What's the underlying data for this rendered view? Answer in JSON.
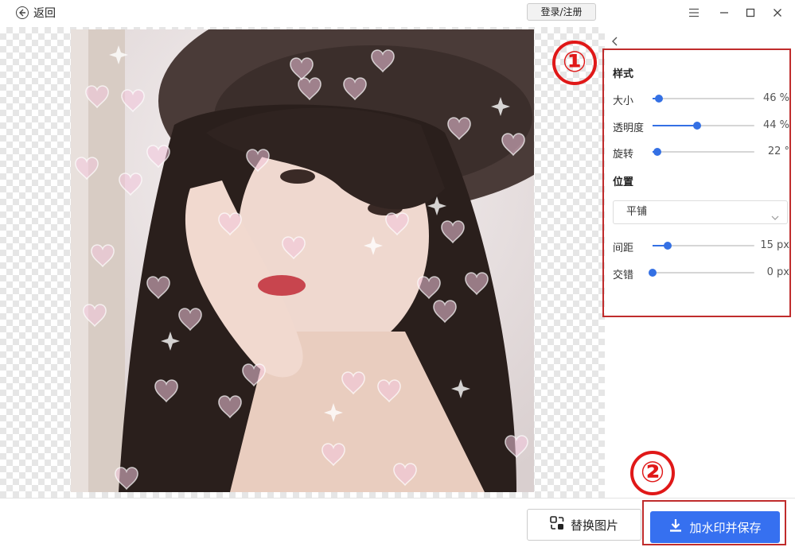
{
  "header": {
    "back_label": "返回",
    "login_label": "登录/注册"
  },
  "panel": {
    "style_title": "样式",
    "size": {
      "label": "大小",
      "value": "46",
      "unit": "%",
      "level": 0.06
    },
    "opacity": {
      "label": "透明度",
      "value": "44",
      "unit": "%",
      "level": 0.44
    },
    "rotation": {
      "label": "旋转",
      "value": "22",
      "unit": "°",
      "level": 0.05
    },
    "position_title": "位置",
    "position_select": "平铺",
    "spacing": {
      "label": "间距",
      "value": "15",
      "unit": "px",
      "level": 0.15
    },
    "stagger": {
      "label": "交错",
      "value": "0",
      "unit": "px",
      "level": 0.0
    }
  },
  "annotations": {
    "one": "①",
    "two": "②"
  },
  "footer": {
    "replace_label": "替换图片",
    "save_label": "加水印并保存"
  },
  "colors": {
    "accent": "#3470e4",
    "annotation": "#e01818"
  }
}
